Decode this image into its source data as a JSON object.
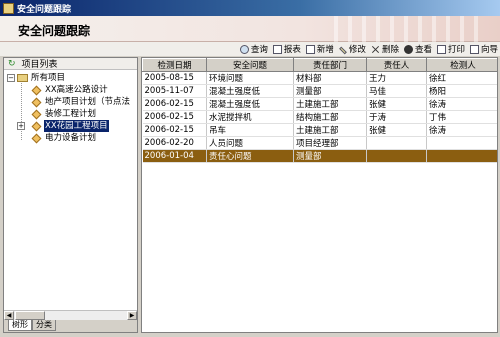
{
  "window": {
    "title": "安全问题跟踪"
  },
  "header": {
    "title": "安全问题跟踪"
  },
  "toolbar": {
    "buttons": [
      {
        "label": "查询",
        "icon": "magnifier-icon"
      },
      {
        "label": "报表",
        "icon": "report-icon"
      },
      {
        "label": "新增",
        "icon": "new-icon"
      },
      {
        "label": "修改",
        "icon": "edit-icon"
      },
      {
        "label": "删除",
        "icon": "delete-icon"
      },
      {
        "label": "查看",
        "icon": "view-icon"
      },
      {
        "label": "打印",
        "icon": "print-icon"
      },
      {
        "label": "向导",
        "icon": "wizard-icon"
      }
    ]
  },
  "sidebar": {
    "header": "项目列表",
    "root": "所有项目",
    "items": [
      "XX高速公路设计",
      "地产项目计划（节点法",
      "装修工程计划",
      "XX花园工程项目",
      "电力设备计划"
    ],
    "selected_index": 3,
    "tabs": [
      "树形",
      "分类"
    ]
  },
  "table": {
    "columns": [
      "检测日期",
      "安全问题",
      "责任部门",
      "责任人",
      "检测人"
    ],
    "rows": [
      [
        "2005-08-15",
        "环境问题",
        "材料部",
        "王力",
        "徐红"
      ],
      [
        "2005-11-07",
        "混凝土强度低",
        "测量部",
        "马佳",
        "杨阳"
      ],
      [
        "2006-02-15",
        "混凝土强度低",
        "土建施工部",
        "张健",
        "徐涛"
      ],
      [
        "2006-02-15",
        "水泥搅拌机",
        "结构施工部",
        "于涛",
        "丁伟"
      ],
      [
        "2006-02-15",
        "吊车",
        "土建施工部",
        "张健",
        "徐涛"
      ],
      [
        "2006-02-20",
        "人员问题",
        "项目经理部",
        "",
        ""
      ],
      [
        "2006-01-04",
        "责任心问题",
        "测量部",
        "",
        ""
      ]
    ],
    "selected_row": 6
  }
}
